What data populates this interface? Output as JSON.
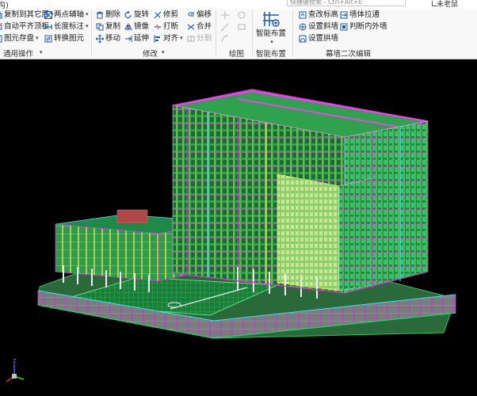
{
  "title_fragment": "沟)",
  "search": {
    "placeholder": "快捷键搜索 - Ctrl+Alt+E"
  },
  "user": {
    "name": "未老鼠"
  },
  "ribbon": {
    "groups": {
      "general": "通用操作",
      "modify": "修改",
      "draw": "绘图",
      "smart": "智能布置",
      "curtain": "幕墙二次编辑"
    },
    "general_items": [
      "复制到其它层",
      "两点辅轴",
      "自动平齐顶板",
      "长度标注",
      "图元存盘",
      "转换图元"
    ],
    "modify_items": [
      "删除",
      "旋转",
      "修剪",
      "偏移",
      "复制",
      "镜像",
      "打断",
      "合并",
      "移动",
      "延伸",
      "对齐",
      "分割"
    ],
    "smart_button": "智能布置",
    "curtain_items": [
      "查改标高",
      "墙体拉通",
      "设置斜墙",
      "判断内外墙",
      "设置拱墙"
    ]
  },
  "colors": {
    "ribbon_bg": "#f8f8f8",
    "viewport_bg": "#000000",
    "icon_blue": "#1e5aa8",
    "icon_red": "#d03030",
    "model_green": "#1fbf4a",
    "model_magenta": "#e030e0",
    "model_yellow": "#e0d020",
    "model_cyan": "#20c8e0",
    "model_gray": "#8c8c8c"
  },
  "icons": [
    "copy-layer-icon",
    "axis-icon",
    "align-top-icon",
    "dimension-icon",
    "save-element-icon",
    "convert-icon",
    "delete-icon",
    "rotate-icon",
    "trim-icon",
    "offset-icon",
    "copy-icon",
    "mirror-icon",
    "break-icon",
    "merge-icon",
    "move-icon",
    "extend-icon",
    "align-icon",
    "split-icon",
    "smart-layout-icon",
    "elevation-icon",
    "wall-stretch-icon",
    "sloped-wall-icon",
    "inner-outer-icon",
    "arch-wall-icon",
    "axis-triad-icon"
  ],
  "viewport": {
    "triad_labels": {
      "x": "X",
      "y": "Y",
      "z": "Z"
    }
  }
}
